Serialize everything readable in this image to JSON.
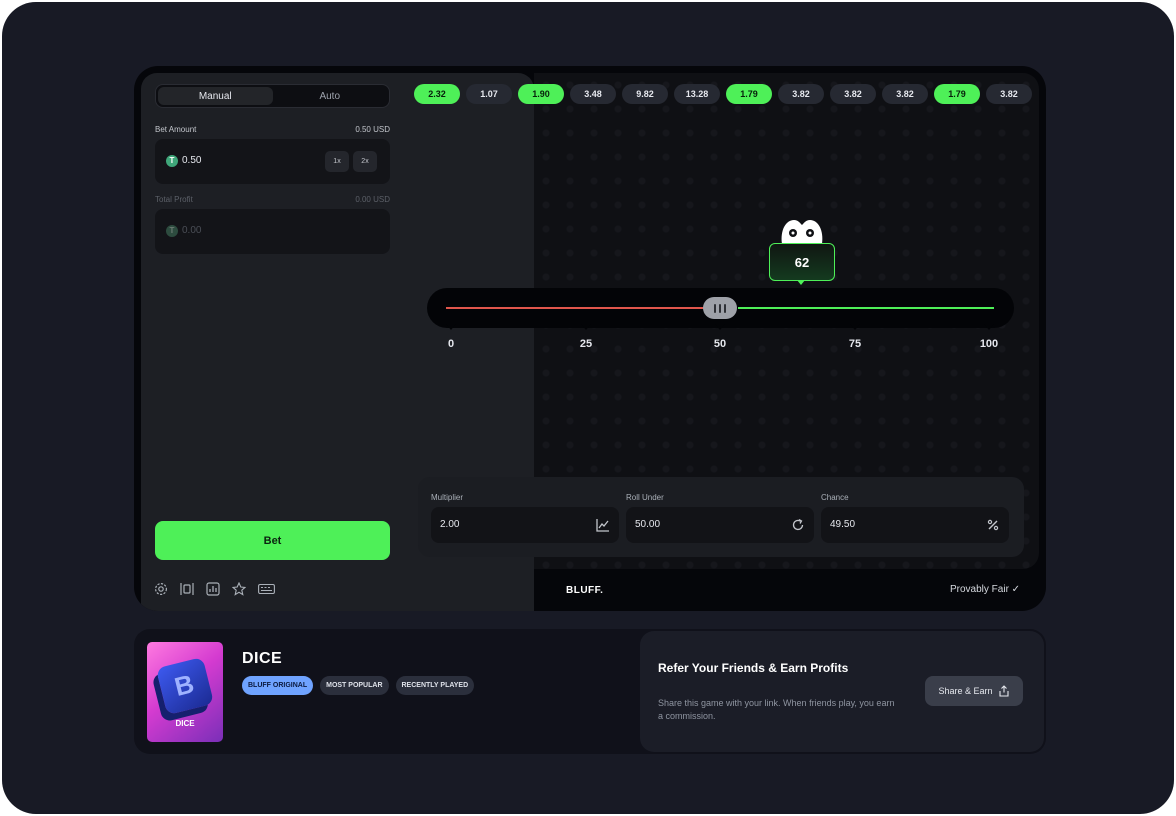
{
  "tabs": [
    {
      "label": "Manual",
      "active": true
    },
    {
      "label": "Auto",
      "active": false
    }
  ],
  "bet_amount": {
    "label": "Bet Amount",
    "usd": "0.50 USD",
    "value": "0.50",
    "half_label": "1x",
    "double_label": "2x"
  },
  "total_profit": {
    "label": "Total Profit",
    "usd": "0.00 USD",
    "value": "0.00"
  },
  "bet_button": "Bet",
  "history": [
    {
      "value": "2.32",
      "win": true
    },
    {
      "value": "1.07",
      "win": false
    },
    {
      "value": "1.90",
      "win": true
    },
    {
      "value": "3.48",
      "win": false
    },
    {
      "value": "9.82",
      "win": false
    },
    {
      "value": "13.28",
      "win": false
    },
    {
      "value": "1.79",
      "win": true
    },
    {
      "value": "3.82",
      "win": false
    },
    {
      "value": "3.82",
      "win": false
    },
    {
      "value": "3.82",
      "win": false
    },
    {
      "value": "1.79",
      "win": true
    },
    {
      "value": "3.82",
      "win": false
    }
  ],
  "slider": {
    "value": 50,
    "min": 0,
    "max": 100,
    "ticks": [
      "0",
      "25",
      "50",
      "75",
      "100"
    ]
  },
  "result": "62",
  "controls": {
    "multiplier": {
      "label": "Multiplier",
      "value": "2.00",
      "icon": "chart-icon"
    },
    "roll_under": {
      "label": "Roll Under",
      "value": "50.00",
      "icon": "refresh-icon"
    },
    "chance": {
      "label": "Chance",
      "value": "49.50",
      "icon": "percent-icon"
    }
  },
  "footer": {
    "brand": "BLUFF.",
    "provably_fair": "Provably Fair ✓"
  },
  "game": {
    "title": "DICE",
    "thumb_label": "DICE",
    "tags": [
      "BLUFF ORIGINAL",
      "MOST POPULAR",
      "RECENTLY PLAYED"
    ]
  },
  "refer": {
    "title": "Refer Your Friends & Earn Profits",
    "desc": "Share this game with your link. When friends play, you earn a commission.",
    "button": "Share & Earn"
  },
  "colors": {
    "accent": "#4ef058",
    "danger": "#e0564c",
    "tag_blue": "#6fa3ff"
  }
}
